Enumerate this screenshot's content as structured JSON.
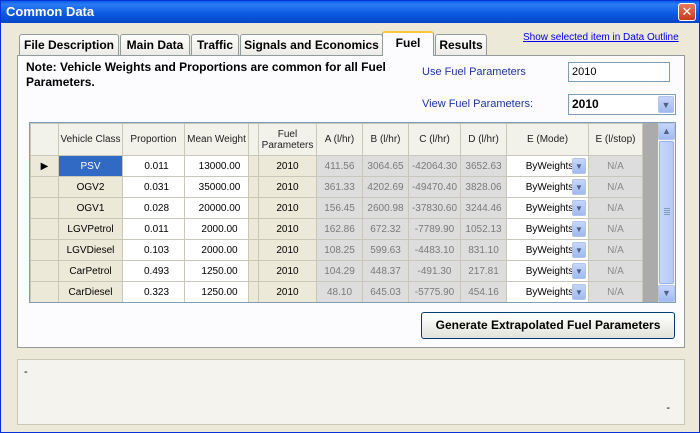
{
  "window": {
    "title": "Common Data",
    "close": "✕"
  },
  "tabs": [
    "File Description",
    "Main Data",
    "Traffic",
    "Signals and Economics",
    "Fuel",
    "Results"
  ],
  "link": "Show selected item in Data Outline",
  "note": "Note: Vehicle Weights and Proportions are common for all Fuel Parameters.",
  "use_fuel": {
    "label": "Use Fuel Parameters",
    "value": "2010"
  },
  "view_fuel": {
    "label": "View Fuel Parameters:",
    "value": "2010"
  },
  "grid": {
    "headers": [
      "Vehicle Class",
      "Proportion",
      "Mean Weight",
      "Fuel Parameters",
      "A (l/hr)",
      "B (l/hr)",
      "C (l/hr)",
      "D (l/hr)",
      "E (Mode)",
      "E (l/stop)"
    ],
    "row_marker": "▶",
    "rows": [
      [
        "PSV",
        "0.011",
        "13000.00",
        "2010",
        "411.56",
        "3064.65",
        "-42064.30",
        "3652.63",
        "ByWeights",
        "N/A"
      ],
      [
        "OGV2",
        "0.031",
        "35000.00",
        "2010",
        "361.33",
        "4202.69",
        "-49470.40",
        "3828.06",
        "ByWeights",
        "N/A"
      ],
      [
        "OGV1",
        "0.028",
        "20000.00",
        "2010",
        "156.45",
        "2600.98",
        "-37830.60",
        "3244.46",
        "ByWeights",
        "N/A"
      ],
      [
        "LGVPetrol",
        "0.011",
        "2000.00",
        "2010",
        "162.86",
        "672.32",
        "-7789.90",
        "1052.13",
        "ByWeights",
        "N/A"
      ],
      [
        "LGVDiesel",
        "0.103",
        "2000.00",
        "2010",
        "108.25",
        "599.63",
        "-4483.10",
        "831.10",
        "ByWeights",
        "N/A"
      ],
      [
        "CarPetrol",
        "0.493",
        "1250.00",
        "2010",
        "104.29",
        "448.37",
        "-491.30",
        "217.81",
        "ByWeights",
        "N/A"
      ],
      [
        "CarDiesel",
        "0.323",
        "1250.00",
        "2010",
        "48.10",
        "645.03",
        "-5775.90",
        "454.16",
        "ByWeights",
        "N/A"
      ]
    ]
  },
  "generate_button": "Generate Extrapolated Fuel Parameters",
  "status": {
    "left": "-",
    "right": "-"
  }
}
